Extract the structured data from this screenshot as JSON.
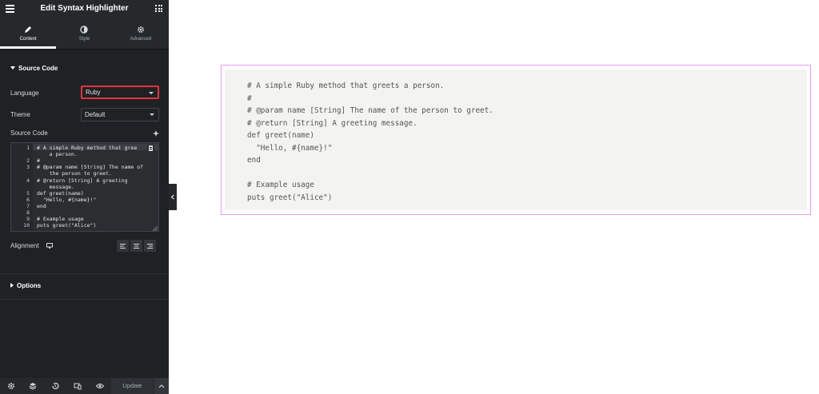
{
  "header": {
    "title": "Edit Syntax Highlighter",
    "menu_icon": "hamburger-icon",
    "apps_icon": "grid-icon"
  },
  "tabs": [
    {
      "label": "Content",
      "icon": "pencil-icon",
      "active": true
    },
    {
      "label": "Style",
      "icon": "contrast-icon",
      "active": false
    },
    {
      "label": "Advanced",
      "icon": "gear-icon",
      "active": false
    }
  ],
  "source_section": {
    "title": "Source Code"
  },
  "language": {
    "label": "Language",
    "value": "Ruby"
  },
  "theme": {
    "label": "Theme",
    "value": "Default"
  },
  "source_code": {
    "label": "Source Code",
    "lines": [
      {
        "n": "1",
        "t": "# A simple Ruby method that gree"
      },
      {
        "n": "",
        "t": "    a person."
      },
      {
        "n": "2",
        "t": "#"
      },
      {
        "n": "3",
        "t": "# @param name [String] The name of"
      },
      {
        "n": "",
        "t": "    the person to greet."
      },
      {
        "n": "4",
        "t": "# @return [String] A greeting"
      },
      {
        "n": "",
        "t": "    message."
      },
      {
        "n": "5",
        "t": "def greet(name)"
      },
      {
        "n": "6",
        "t": "  \"Hello, #{name}!\""
      },
      {
        "n": "7",
        "t": "end"
      },
      {
        "n": "8",
        "t": ""
      },
      {
        "n": "9",
        "t": "# Example usage"
      },
      {
        "n": "10",
        "t": "puts greet(\"Alice\")"
      }
    ]
  },
  "alignment": {
    "label": "Alignment"
  },
  "options_section": {
    "title": "Options"
  },
  "footer": {
    "update_label": "Update"
  },
  "preview": {
    "code": "# A simple Ruby method that greets a person.\n#\n# @param name [String] The name of the person to greet.\n# @return [String] A greeting message.\ndef greet(name)\n  \"Hello, #{name}!\"\nend\n\n# Example usage\nputs greet(\"Alice\")"
  },
  "colors": {
    "panel_bg": "#1f2124",
    "highlight_border": "#e2363c",
    "preview_border": "#e89be8",
    "code_bg": "#f3f3f0"
  }
}
